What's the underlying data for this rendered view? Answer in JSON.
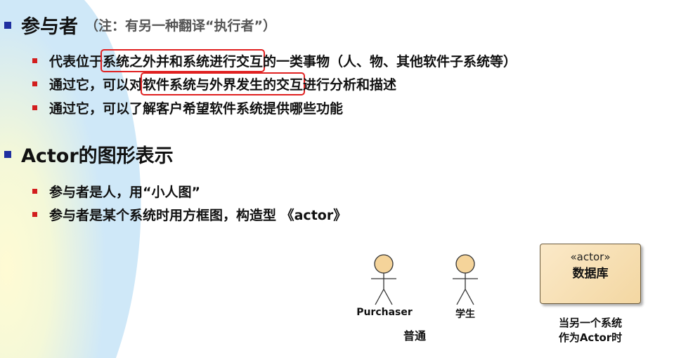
{
  "section1": {
    "title": "参与者",
    "note": "（注：有另一种翻译“执行者”）",
    "bullets": [
      {
        "before": "代表位于",
        "highlight": "系统之外并和系统进行交互",
        "after": "的一类事物（人、物、其他软件子系统等）"
      },
      {
        "before": "通过它，可以对",
        "highlight": "软件系统与外界发生的交互",
        "after": "进行分析和描述"
      },
      {
        "before": "通过它，可以了解客户希望软件系统提供哪些功能",
        "highlight": "",
        "after": ""
      }
    ]
  },
  "section2": {
    "title": "Actor的图形表示",
    "bullets": [
      "参与者是人，用“小人图”",
      "参与者是某个系统时用方框图，构造型 《actor》"
    ]
  },
  "diagram": {
    "actor1_label": "Purchaser",
    "actor2_label": "学生",
    "ordinary_caption": "普通",
    "box_stereotype": "«actor»",
    "box_name": "数据库",
    "system_caption_line1": "当另一个系统",
    "system_caption_line2": "作为Actor时"
  },
  "colors": {
    "bullet1": "#1f2fa0",
    "bullet2": "#d21e1e",
    "highlight_box": "#e02020",
    "actor_head": "#f5d49a"
  }
}
